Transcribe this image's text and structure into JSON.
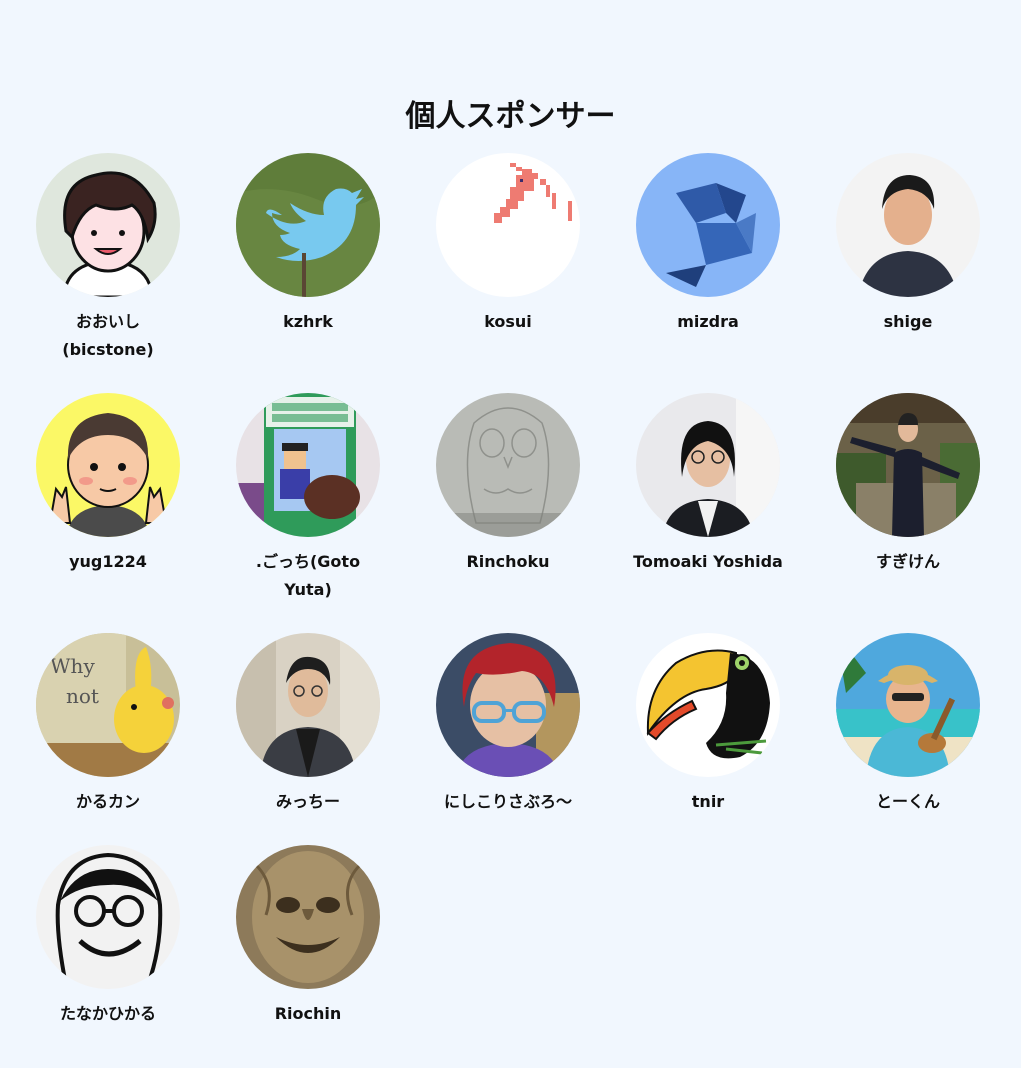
{
  "section": {
    "title": "個人スポンサー"
  },
  "sponsors": [
    {
      "name": "おおいし (bicstone)",
      "icon": "cartoon-portrait-icon",
      "bg": "#dfe7dd"
    },
    {
      "name": "kzhrk",
      "icon": "twitter-bird-icon",
      "bg": "#5f7d3a"
    },
    {
      "name": "kosui",
      "icon": "pixel-shrimp-icon",
      "bg": "#ffffff"
    },
    {
      "name": "mizdra",
      "icon": "geometric-bird-icon",
      "bg": "#87b5f7"
    },
    {
      "name": "shige",
      "icon": "photo-portrait-icon",
      "bg": "#f3f3f3"
    },
    {
      "name": "yug1224",
      "icon": "cartoon-peace-sign-icon",
      "bg": "#fbf866"
    },
    {
      "name": ".ごっち(Goto Yuta)",
      "icon": "thick-mints-icon",
      "bg": "#e8e2e6"
    },
    {
      "name": "Rinchoku",
      "icon": "owl-sketch-icon",
      "bg": "#b9bbb6"
    },
    {
      "name": "Tomoaki Yoshida",
      "icon": "photo-portrait-icon",
      "bg": "#e9e9ec"
    },
    {
      "name": "すぎけん",
      "icon": "photo-garden-portrait-icon",
      "bg": "#6b6148"
    },
    {
      "name": "かるカン",
      "icon": "yellow-plush-icon",
      "bg": "#b8ab84"
    },
    {
      "name": "みっちー",
      "icon": "photo-portrait-icon",
      "bg": "#d9d2c4"
    },
    {
      "name": "にしこりさぶろ〜",
      "icon": "3d-avatar-icon",
      "bg": "#3b4c66"
    },
    {
      "name": "tnir",
      "icon": "toucan-icon",
      "bg": "#ffffff"
    },
    {
      "name": "とーくん",
      "icon": "beach-ukulele-icon",
      "bg": "#4fa8dd"
    },
    {
      "name": "たなかひかる",
      "icon": "sketch-face-icon",
      "bg": "#f2f2f2"
    },
    {
      "name": "Riochin",
      "icon": "tree-face-icon",
      "bg": "#8d7a5a"
    }
  ]
}
